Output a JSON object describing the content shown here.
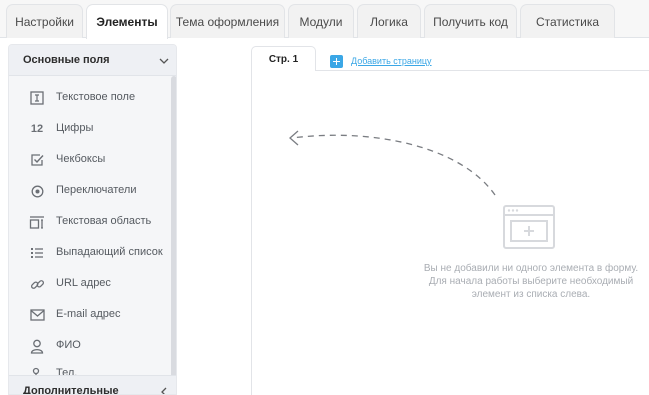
{
  "tabs": [
    {
      "label": "Настройки"
    },
    {
      "label": "Элементы"
    },
    {
      "label": "Тема оформления"
    },
    {
      "label": "Модули"
    },
    {
      "label": "Логика"
    },
    {
      "label": "Получить код"
    },
    {
      "label": "Статистика"
    }
  ],
  "active_tab": "Элементы",
  "sidebar": {
    "section_basic": "Основные поля",
    "section_extra": "Дополнительные",
    "items": [
      {
        "label": "Текстовое поле",
        "icon": "text-field-icon"
      },
      {
        "label": "Цифры",
        "icon": "numbers-icon",
        "icon_text": "12"
      },
      {
        "label": "Чекбоксы",
        "icon": "checkbox-icon"
      },
      {
        "label": "Переключатели",
        "icon": "radio-icon"
      },
      {
        "label": "Текстовая область",
        "icon": "textarea-icon"
      },
      {
        "label": "Выпадающий список",
        "icon": "list-icon"
      },
      {
        "label": "URL адрес",
        "icon": "link-icon"
      },
      {
        "label": "E-mail адрес",
        "icon": "mail-icon"
      },
      {
        "label": "ФИО",
        "icon": "user-icon"
      },
      {
        "label": "Тел.",
        "icon": "phone-icon"
      }
    ]
  },
  "canvas": {
    "page_tab": "Стр. 1",
    "add_page": "Добавить страницу",
    "empty_lines": [
      "Вы не добавили ни одного элемента в форму.",
      "Для начала работы выберите необходимый",
      "элемент из списка слева."
    ]
  },
  "colors": {
    "accent": "#3ba7e6",
    "icon": "#6b6f75",
    "muted_text": "#a9adb3"
  }
}
